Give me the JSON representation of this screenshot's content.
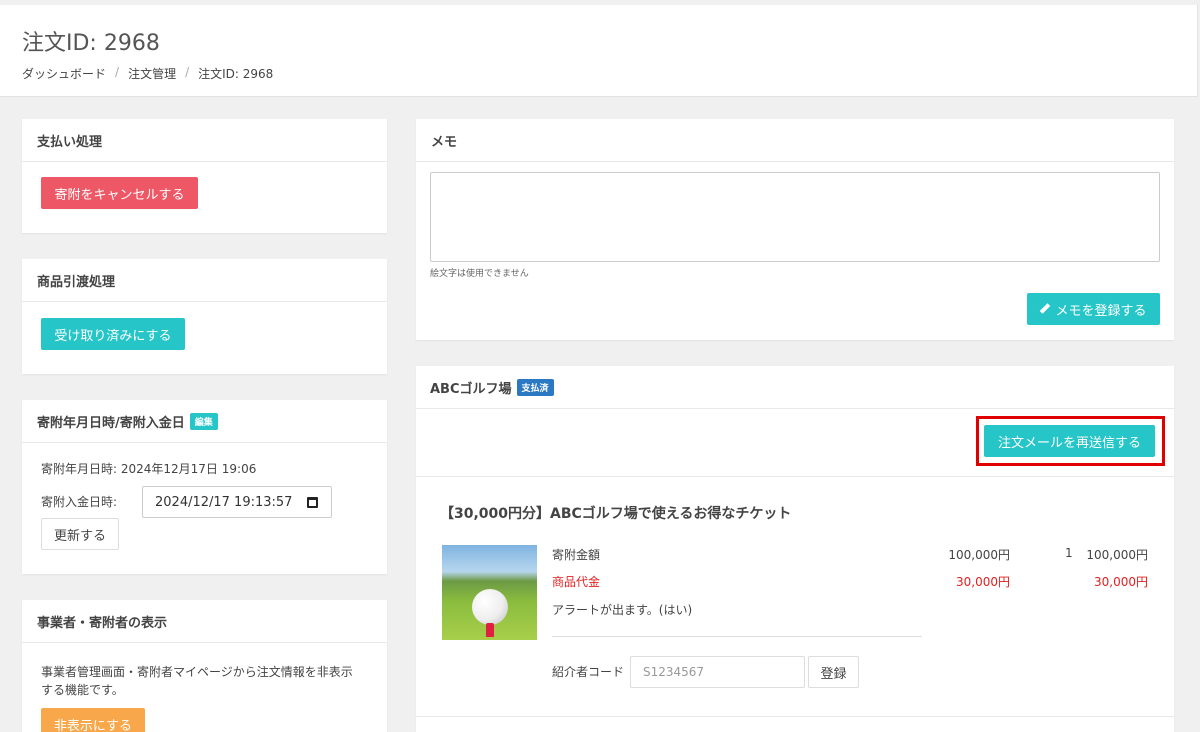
{
  "header": {
    "title": "注文ID: 2968",
    "breadcrumb": [
      "ダッシュボード",
      "注文管理",
      "注文ID: 2968"
    ]
  },
  "payment": {
    "title": "支払い処理",
    "cancel_label": "寄附をキャンセルする"
  },
  "delivery": {
    "title": "商品引渡処理",
    "received_label": "受け取り済みにする"
  },
  "dates": {
    "title": "寄附年月日時/寄附入金日",
    "badge": "編集",
    "donation_datetime": "寄附年月日時: 2024年12月17日 19:06",
    "deposit_label": "寄附入金日時:",
    "deposit_value": "2024/12/17 19:13:57",
    "update_label": "更新する"
  },
  "display": {
    "title": "事業者・寄附者の表示",
    "description_line1": "事業者管理画面・寄附者マイページから注文情報を非表示",
    "description_line2": "する機能です。",
    "hide_label": "非表示にする"
  },
  "memo": {
    "title": "メモ",
    "value": "",
    "hint": "絵文字は使用できません",
    "save_label": "メモを登録する"
  },
  "order": {
    "shop_name": "ABCゴルフ場",
    "status_badge": "支払済",
    "resend_label": "注文メールを再送信する",
    "product_title": "【30,000円分】ABCゴルフ場で使えるお得なチケット",
    "rows": [
      {
        "label": "寄附金額",
        "unit_price": "100,000円",
        "qty": "1",
        "total": "100,000円"
      },
      {
        "label": "商品代金",
        "unit_price": "30,000円",
        "qty": "",
        "total": "30,000円"
      }
    ],
    "alert_note": "アラートが出ます。(はい)",
    "referral_label": "紹介者コード",
    "referral_placeholder": "S1234567",
    "register_label": "登録"
  },
  "colors": {
    "teal": "#26c5c8",
    "red": "#ee5866",
    "orange": "#f8a84a",
    "highlight": "#e00000"
  }
}
